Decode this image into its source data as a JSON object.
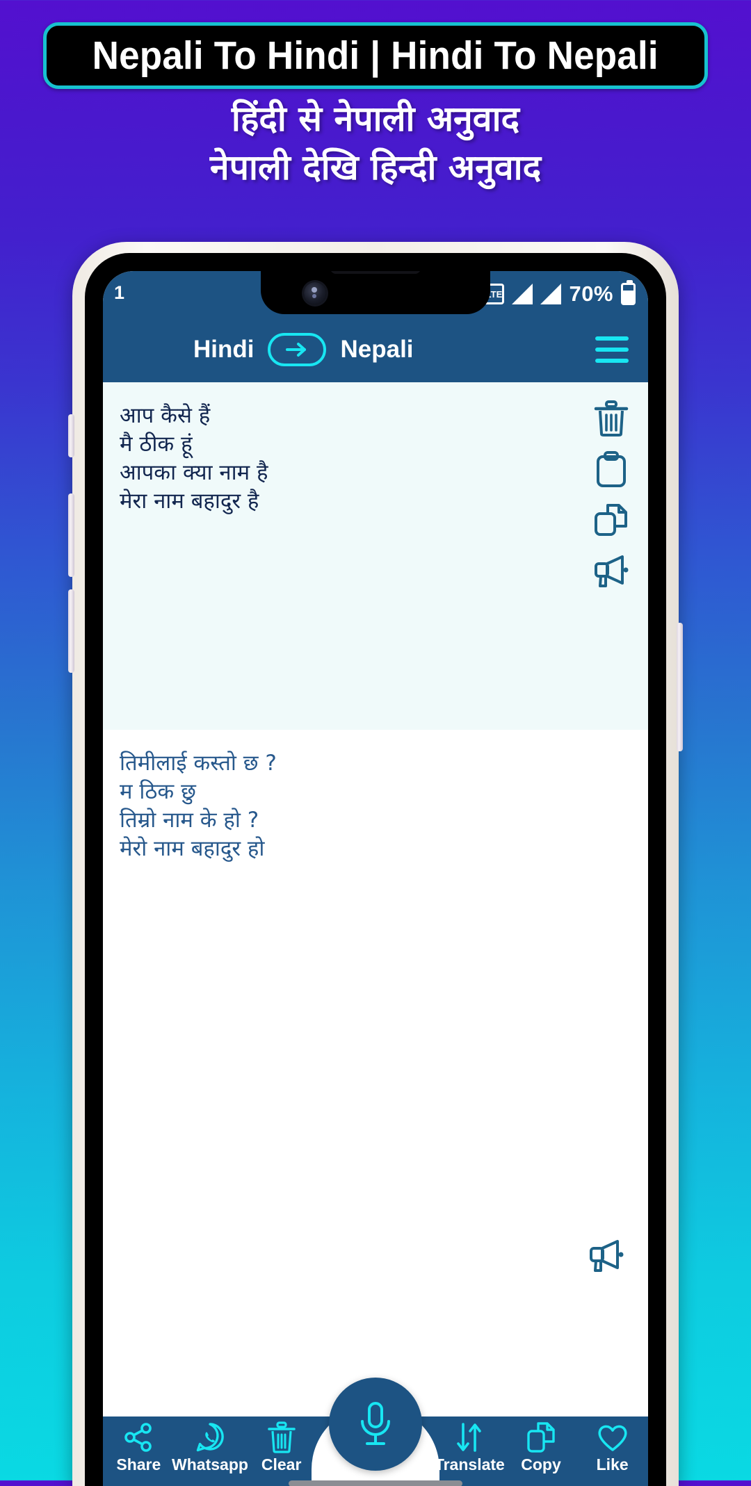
{
  "promo": {
    "banner_title": "Nepali To Hindi | Hindi To Nepali",
    "subtitle_line1": "हिंदी से नेपाली अनुवाद",
    "subtitle_line2": "नेपाली देखि हिन्दी अनुवाद",
    "banner_border_color": "#17c2cf",
    "banner_bg_color": "#000000",
    "bg_gradient_top": "#5310cf",
    "bg_gradient_bottom": "#0ad9e3"
  },
  "status_bar": {
    "time": "1",
    "network_label": "LTE",
    "battery_percent": "70%",
    "bg_color": "#1d5383"
  },
  "app_bar": {
    "source_language": "Hindi",
    "target_language": "Nepali",
    "swap_icon": "arrow-right-icon",
    "menu_icon": "hamburger-menu-icon",
    "accent_color": "#18e6f2",
    "bg_color": "#1d5383"
  },
  "input_panel": {
    "text": "आप कैसे हैं\n मै ठीक हूं\n आपका क्या नाम है\nमेरा नाम बहादुर है",
    "bg_color": "#f0fafa",
    "text_color": "#12264f",
    "actions": [
      {
        "name": "delete-icon",
        "label": "Delete"
      },
      {
        "name": "paste-icon",
        "label": "Paste"
      },
      {
        "name": "copy-icon",
        "label": "Copy"
      },
      {
        "name": "speak-icon",
        "label": "Speak"
      }
    ]
  },
  "output_panel": {
    "text": "तिमीलाई कस्तो छ ?\nम ठिक छु\nतिम्रो नाम के हो ?\nमेरो नाम बहादुर हो",
    "bg_color": "#ffffff",
    "text_color": "#27588c",
    "speak_icon": "speak-icon"
  },
  "bottom_bar": {
    "bg_color": "#1d5383",
    "icon_color": "#18e6f2",
    "left_items": [
      {
        "label": "Share",
        "icon": "share-icon"
      },
      {
        "label": "Whatsapp",
        "icon": "whatsapp-icon"
      },
      {
        "label": "Clear",
        "icon": "trash-icon"
      }
    ],
    "right_items": [
      {
        "label": "Translate",
        "icon": "translate-swap-icon"
      },
      {
        "label": "Copy",
        "icon": "copy-icon"
      },
      {
        "label": "Like",
        "icon": "heart-icon"
      }
    ],
    "fab": {
      "label": "Voice input",
      "icon": "microphone-icon"
    }
  }
}
